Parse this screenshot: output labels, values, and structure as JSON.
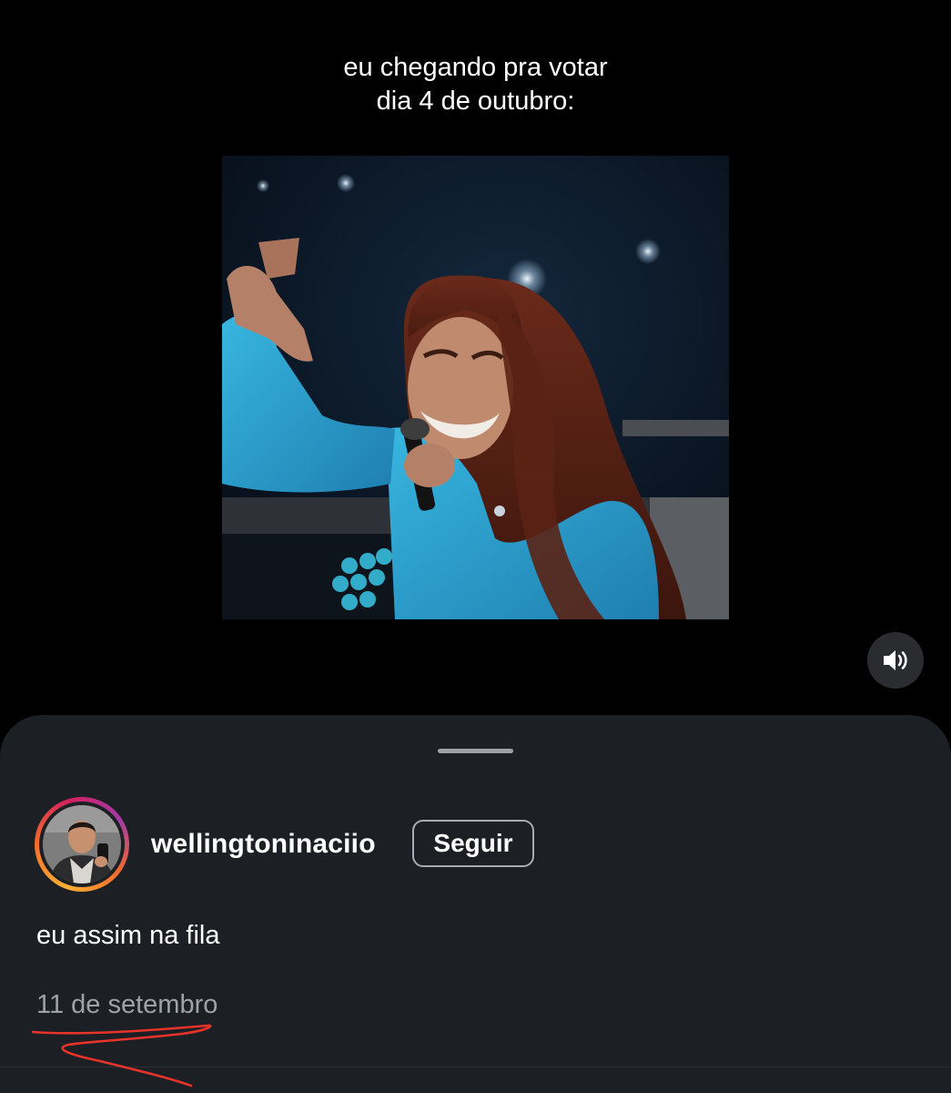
{
  "caption": {
    "line1": "eu chegando pra votar",
    "line2": "dia 4 de outubro:"
  },
  "sound_button": {
    "icon": "speaker-icon"
  },
  "post": {
    "username": "wellingtoninaciio",
    "follow_label": "Seguir",
    "text": "eu assim na fila",
    "date": "11 de setembro"
  },
  "colors": {
    "background": "#000000",
    "sheet": "#1c1f24",
    "date_text": "#9ea3a9",
    "annotation": "#e8332a"
  }
}
